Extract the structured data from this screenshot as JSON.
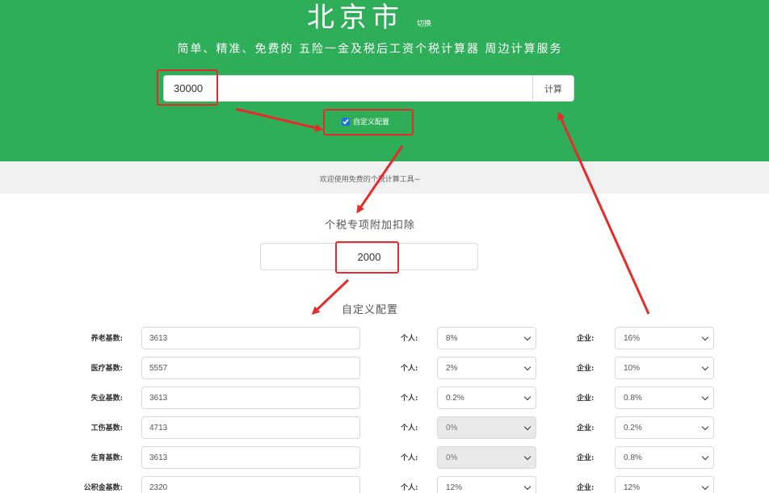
{
  "header": {
    "city": "北京市",
    "switch_label": "切换",
    "subtitle": "简单、精准、免费的 五险一金及税后工资个税计算器 周边计算服务",
    "salary_value": "30000",
    "calc_label": "计算",
    "custom_config_label": "自定义配置",
    "custom_config_checked": true
  },
  "welcome": "欢迎使用免费的个税计算工具~",
  "deduction": {
    "title": "个税专项附加扣除",
    "value": "2000"
  },
  "config": {
    "title": "自定义配置",
    "person_label": "个人:",
    "company_label": "企业:",
    "rows": [
      {
        "label": "养老基数:",
        "base": "3613",
        "personal": "8%",
        "personal_disabled": false,
        "company": "16%"
      },
      {
        "label": "医疗基数:",
        "base": "5557",
        "personal": "2%",
        "personal_disabled": false,
        "company": "10%"
      },
      {
        "label": "失业基数:",
        "base": "3613",
        "personal": "0.2%",
        "personal_disabled": false,
        "company": "0.8%"
      },
      {
        "label": "工伤基数:",
        "base": "4713",
        "personal": "0%",
        "personal_disabled": true,
        "company": "0.2%"
      },
      {
        "label": "生育基数:",
        "base": "3613",
        "personal": "0%",
        "personal_disabled": true,
        "company": "0.8%"
      },
      {
        "label": "公积金基数:",
        "base": "2320",
        "personal": "12%",
        "personal_disabled": false,
        "company": "12%"
      }
    ]
  },
  "colors": {
    "header_bg": "#2fae5a",
    "annotation_red": "#e52b2b"
  }
}
